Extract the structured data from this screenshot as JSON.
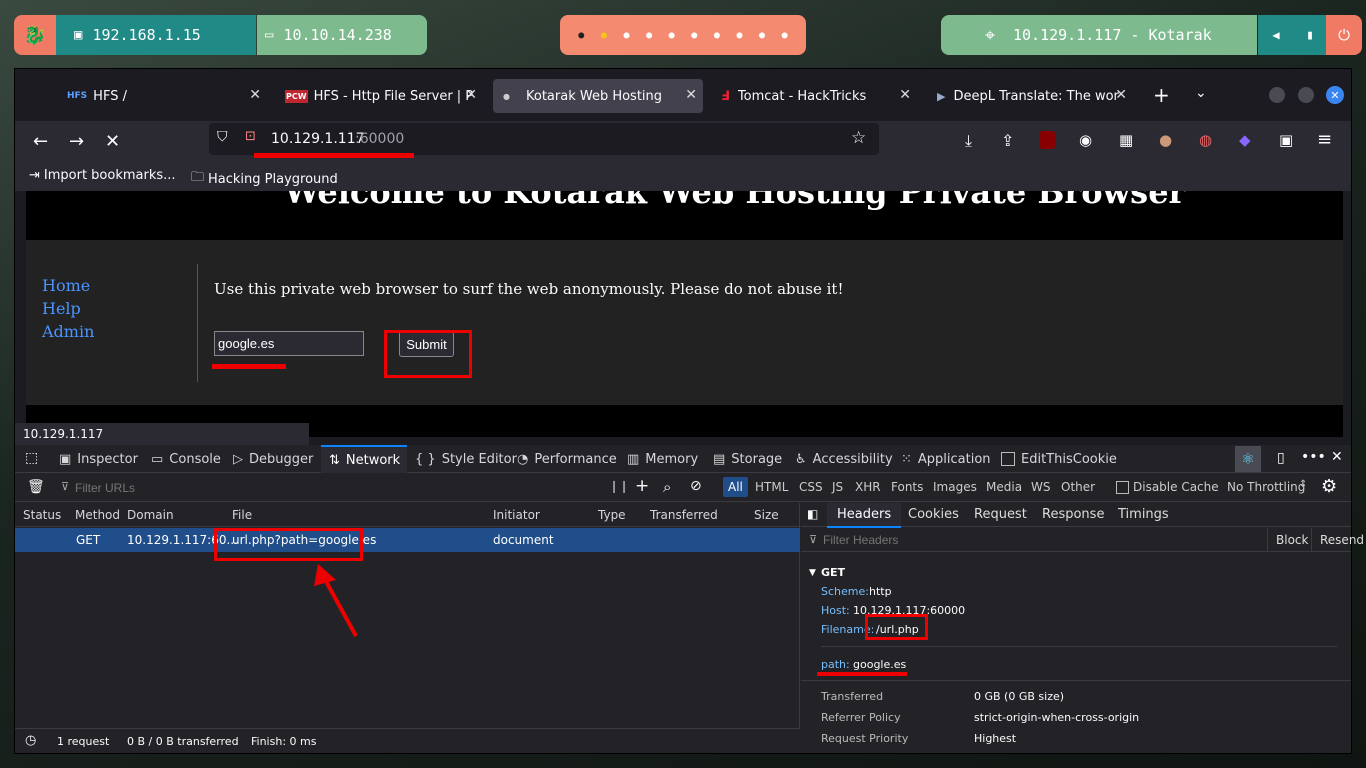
{
  "taskbar": {
    "ip1": "192.168.1.15",
    "ip2": "10.10.14.238",
    "target": "10.129.1.117 - Kotarak"
  },
  "tabs": [
    {
      "label": "HFS /"
    },
    {
      "label": "HFS - Http File Server | PC"
    },
    {
      "label": "Kotarak Web Hosting"
    },
    {
      "label": "Tomcat - HackTricks"
    },
    {
      "label": "DeepL Translate: The wor"
    }
  ],
  "address": {
    "host": "10.129.1.117",
    "port": ":60000"
  },
  "bookmarks": {
    "import": "Import bookmarks...",
    "folder": "Hacking Playground"
  },
  "page": {
    "heading": "Welcome to Kotarak Web Hosting Private Browser",
    "nav": [
      "Home",
      "Help",
      "Admin"
    ],
    "intro": "Use this private web browser to surf the web anonymously. Please do not abuse it!",
    "input_value": "google.es",
    "submit": "Submit"
  },
  "status_url": "10.129.1.117",
  "devtools": {
    "tabs": [
      "Inspector",
      "Console",
      "Debugger",
      "Network",
      "Style Editor",
      "Performance",
      "Memory",
      "Storage",
      "Accessibility",
      "Application",
      "EditThisCookie"
    ],
    "filter_placeholder": "Filter URLs",
    "types": [
      "All",
      "HTML",
      "CSS",
      "JS",
      "XHR",
      "Fonts",
      "Images",
      "Media",
      "WS",
      "Other"
    ],
    "disable_cache": "Disable Cache",
    "throttling": "No Throttling",
    "columns": [
      "Status",
      "Method",
      "Domain",
      "File",
      "Initiator",
      "Type",
      "Transferred",
      "Size"
    ],
    "request": {
      "method": "GET",
      "domain": "10.129.1.117:60...",
      "file": "url.php?path=google.es",
      "initiator": "document"
    },
    "footer": {
      "count": "1 request",
      "transferred": "0 B / 0 B transferred",
      "finish": "Finish: 0 ms"
    },
    "panel_tabs": [
      "Headers",
      "Cookies",
      "Request",
      "Response",
      "Timings"
    ],
    "filter_headers": "Filter Headers",
    "block": "Block",
    "resend": "Resend",
    "get": "GET",
    "scheme_label": "Scheme:",
    "scheme": "http",
    "host_label": "Host:",
    "host": "10.129.1.117:60000",
    "filename_label": "Filename:",
    "filename": "/url.php",
    "path_label": "path:",
    "path": "google.es",
    "transferred_label": "Transferred",
    "transferred_value": "0 GB (0 GB size)",
    "referrer_label": "Referrer Policy",
    "referrer_value": "strict-origin-when-cross-origin",
    "priority_label": "Request Priority",
    "priority_value": "Highest"
  }
}
